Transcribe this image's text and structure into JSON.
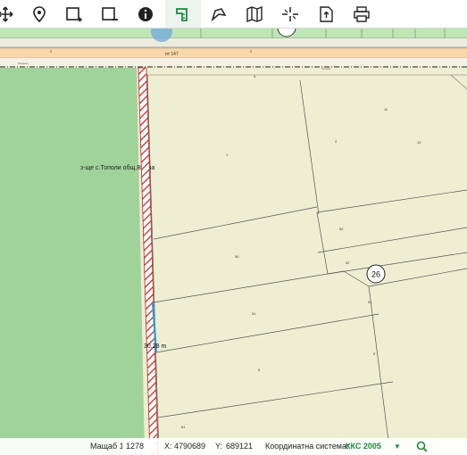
{
  "toolbar": {
    "tools": [
      {
        "name": "pan",
        "icon": "move-arrows-icon"
      },
      {
        "name": "point",
        "icon": "location-pin-icon"
      },
      {
        "name": "zoom-in-box",
        "icon": "zoom-box-plus-icon"
      },
      {
        "name": "zoom-out-box",
        "icon": "zoom-box-minus-icon"
      },
      {
        "name": "info",
        "icon": "info-icon"
      },
      {
        "name": "measure",
        "icon": "measure-ruler-icon",
        "active": true
      },
      {
        "name": "area",
        "icon": "polygon-icon"
      },
      {
        "name": "layers",
        "icon": "map-layers-icon"
      },
      {
        "name": "crosshair",
        "icon": "crosshair-icon"
      },
      {
        "name": "export",
        "icon": "export-document-icon"
      },
      {
        "name": "print",
        "icon": "printer-icon"
      }
    ]
  },
  "map": {
    "locality_label": "з-ще с.Тополи общ.Варна",
    "road_label": "пт 147",
    "road_number_left": "2",
    "road_number_right": "2",
    "measurement_label": "30.28 m",
    "point_label": "26",
    "parcels": [
      "1",
      "2",
      "11",
      "12",
      "4",
      "50",
      "52",
      "52",
      "51",
      "51",
      "5",
      "5",
      "61"
    ],
    "top_parcels": [
      "81",
      "85",
      "83",
      "84",
      "85"
    ],
    "road_small_labels": [
      "Лозенец",
      "Тополи"
    ],
    "colors": {
      "forest": "#9fd39a",
      "parcel_fill": "#eeeed2",
      "road_fill": "#f8d8a8",
      "top_strip": "#bfe6b5",
      "hatch": "#c0221f",
      "measure_line": "#2b9ed8",
      "accent": "#1e8a3c"
    }
  },
  "status": {
    "scale_label": "Мащаб 1:",
    "scale_value": "1278",
    "x_label": "X:",
    "x_value": "4790689",
    "y_label": "Y:",
    "y_value": "689121",
    "crs_label": "Координатна система:",
    "crs_value": "ККС 2005",
    "crs_dropdown": "▼"
  }
}
